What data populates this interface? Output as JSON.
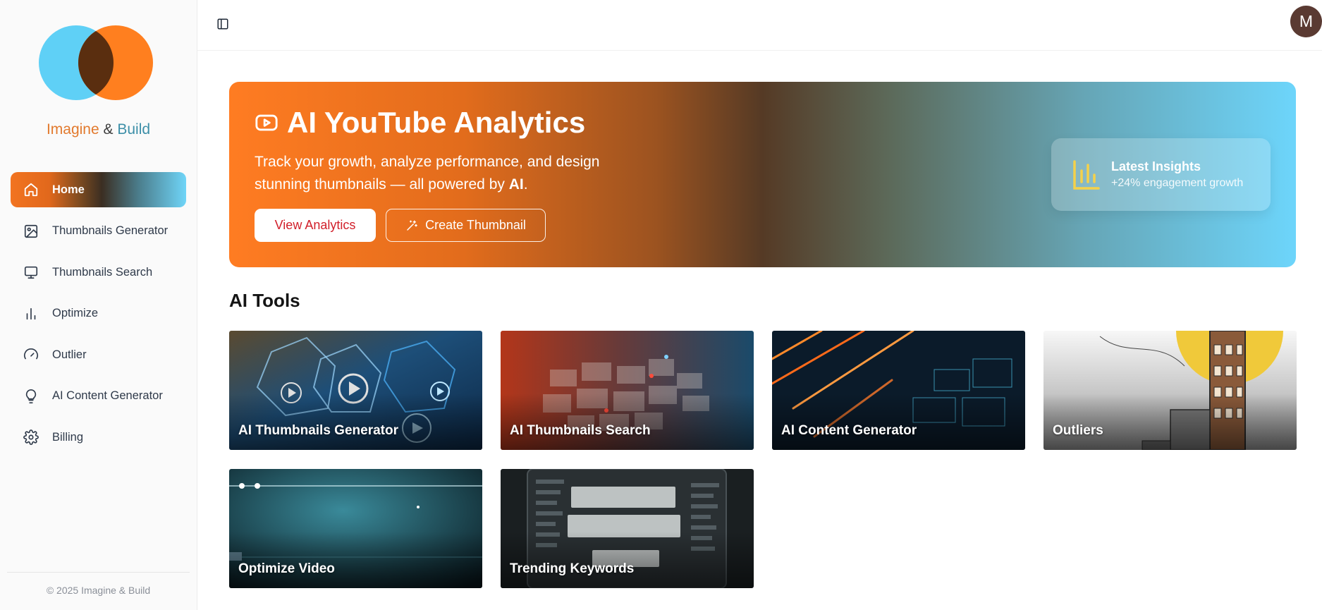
{
  "brand": {
    "word1": "Imagine",
    "amp": "&",
    "word2": "Build"
  },
  "sidebar": {
    "items": [
      {
        "label": "Home",
        "icon": "home-icon",
        "active": true
      },
      {
        "label": "Thumbnails Generator",
        "icon": "image-icon"
      },
      {
        "label": "Thumbnails Search",
        "icon": "monitor-icon"
      },
      {
        "label": "Optimize",
        "icon": "bar-chart-icon"
      },
      {
        "label": "Outlier",
        "icon": "gauge-icon"
      },
      {
        "label": "AI Content Generator",
        "icon": "lightbulb-icon"
      },
      {
        "label": "Billing",
        "icon": "gear-icon"
      }
    ],
    "footer": "© 2025 Imagine & Build"
  },
  "topbar": {
    "avatar_initial": "M"
  },
  "hero": {
    "title": "AI YouTube Analytics",
    "subtitle_prefix": "Track your growth, analyze performance, and design stunning thumbnails — all powered by ",
    "subtitle_bold": "AI",
    "subtitle_suffix": ".",
    "primary_button": "View Analytics",
    "secondary_button": "Create Thumbnail",
    "insight_title": "Latest Insights",
    "insight_text": "+24% engagement growth"
  },
  "tools": {
    "title": "AI Tools",
    "cards": [
      {
        "label": "AI Thumbnails Generator"
      },
      {
        "label": "AI Thumbnails Search"
      },
      {
        "label": "AI Content Generator"
      },
      {
        "label": "Outliers"
      },
      {
        "label": "Optimize Video"
      },
      {
        "label": "Trending Keywords"
      }
    ]
  },
  "colors": {
    "accent_orange": "#ff7c22",
    "accent_blue": "#6dd5fb",
    "primary_button_text": "#d11f2a"
  }
}
